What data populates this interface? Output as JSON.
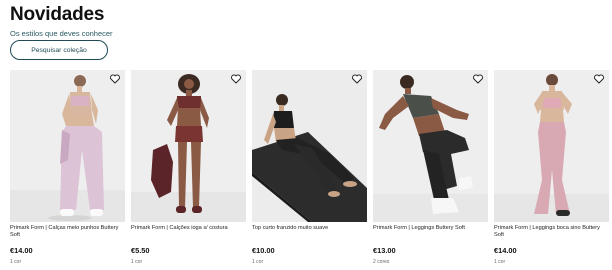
{
  "section": {
    "title": "Novidades",
    "subtitle": "Os estilos que deves conhecer",
    "cta_label": "Pesquisar coleção"
  },
  "products": [
    {
      "name": "Primark Form | Calças meio punhos Buttery Soft",
      "price": "€14.00",
      "colors": "1 cor",
      "image": "model-lilac-sports-bra-joggers",
      "favorite_icon": "heart-outline-icon"
    },
    {
      "name": "Primark Form | Calções ioga s/ costura",
      "price": "€5.50",
      "colors": "1 cor",
      "image": "model-burgundy-set-shorts",
      "favorite_icon": "heart-outline-icon"
    },
    {
      "name": "Top curto franzido muito suave",
      "price": "€10.00",
      "colors": "1 cor",
      "image": "model-black-top-on-yoga-mat",
      "favorite_icon": "heart-outline-icon"
    },
    {
      "name": "Primark Form | Leggings Buttery Soft",
      "price": "€13.00",
      "colors": "2 cores",
      "image": "model-black-leggings-crouching",
      "favorite_icon": "heart-outline-icon"
    },
    {
      "name": "Primark Form | Leggings boca sino Buttery Soft",
      "price": "€14.00",
      "colors": "1 cor",
      "image": "model-pink-flared-leggings",
      "favorite_icon": "heart-outline-icon"
    }
  ],
  "colors": {
    "accent": "#1f4a54",
    "subtitle": "#2b5a64",
    "photo_background": "#efefef"
  }
}
